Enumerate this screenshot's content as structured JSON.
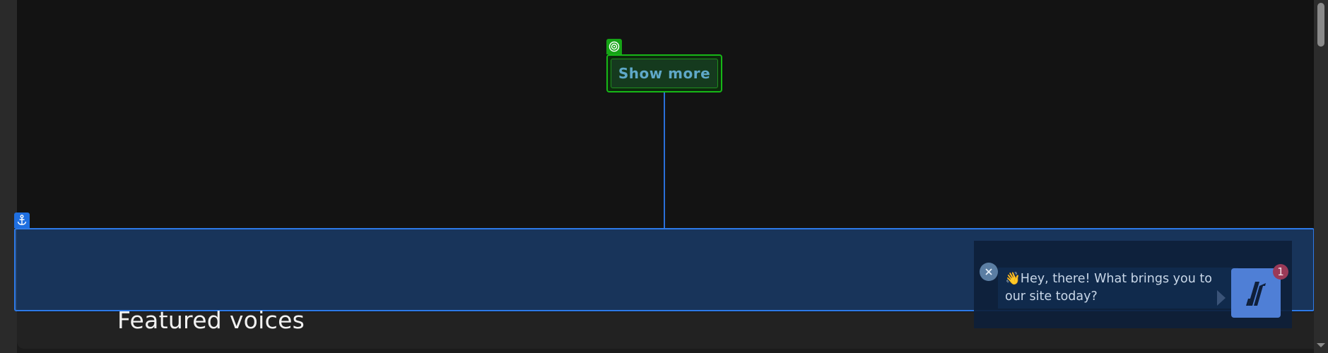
{
  "main": {
    "show_more_label": "Show more",
    "featured_heading": "Featured voices"
  },
  "overlays": {
    "target_icon": "target-icon",
    "anchor_icon": "anchor-icon",
    "target_color": "#17b717",
    "anchor_color": "#2d7ae8"
  },
  "chat": {
    "greeting_emoji": "👋",
    "greeting_text": "Hey, there! What brings you to our site today?",
    "notification_count": "1",
    "close_icon": "close-icon",
    "launcher_icon": "brand-logo-icon",
    "accent": "#4f7fd6"
  }
}
